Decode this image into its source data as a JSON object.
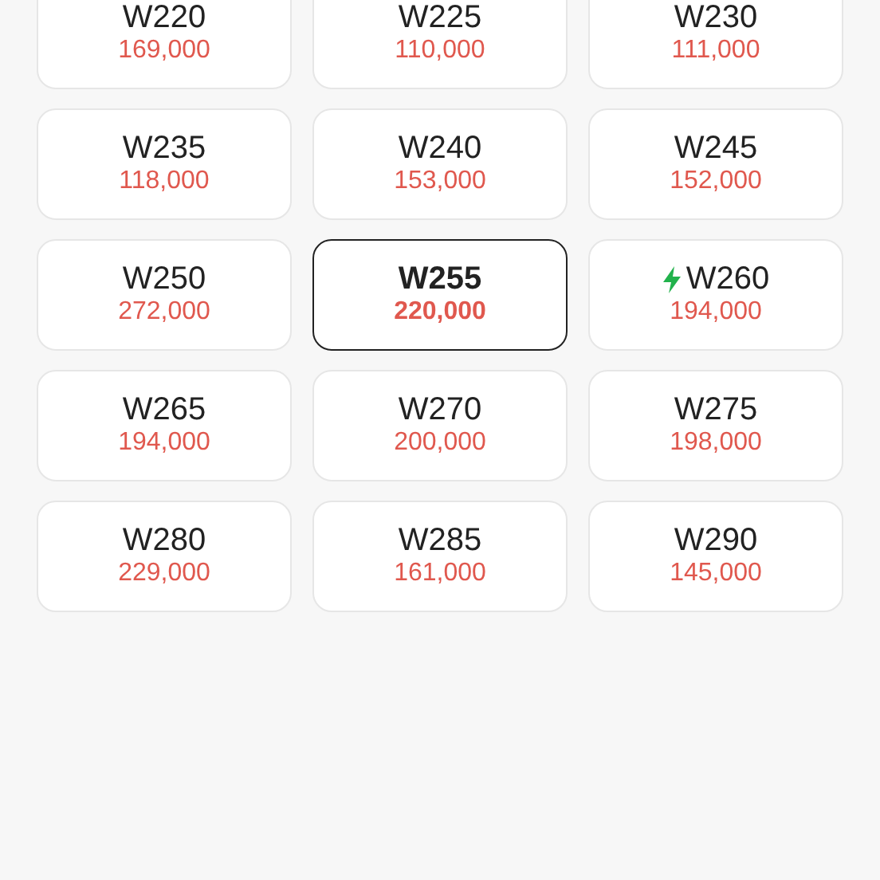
{
  "sizes": [
    {
      "size": "W220",
      "price": "169,000",
      "selected": false,
      "express": false
    },
    {
      "size": "W225",
      "price": "110,000",
      "selected": false,
      "express": false
    },
    {
      "size": "W230",
      "price": "111,000",
      "selected": false,
      "express": false
    },
    {
      "size": "W235",
      "price": "118,000",
      "selected": false,
      "express": false
    },
    {
      "size": "W240",
      "price": "153,000",
      "selected": false,
      "express": false
    },
    {
      "size": "W245",
      "price": "152,000",
      "selected": false,
      "express": false
    },
    {
      "size": "W250",
      "price": "272,000",
      "selected": false,
      "express": false
    },
    {
      "size": "W255",
      "price": "220,000",
      "selected": true,
      "express": false
    },
    {
      "size": "W260",
      "price": "194,000",
      "selected": false,
      "express": true
    },
    {
      "size": "W265",
      "price": "194,000",
      "selected": false,
      "express": false
    },
    {
      "size": "W270",
      "price": "200,000",
      "selected": false,
      "express": false
    },
    {
      "size": "W275",
      "price": "198,000",
      "selected": false,
      "express": false
    },
    {
      "size": "W280",
      "price": "229,000",
      "selected": false,
      "express": false
    },
    {
      "size": "W285",
      "price": "161,000",
      "selected": false,
      "express": false
    },
    {
      "size": "W290",
      "price": "145,000",
      "selected": false,
      "express": false
    }
  ]
}
